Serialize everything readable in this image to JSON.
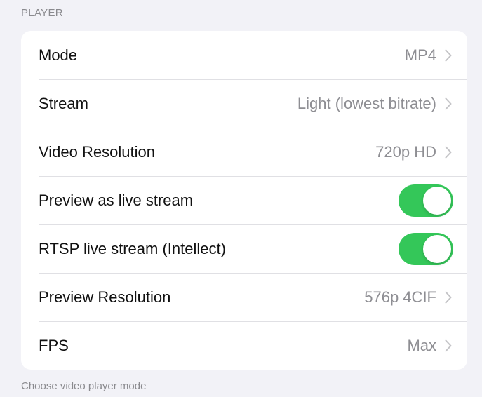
{
  "section": {
    "header": "PLAYER",
    "footer": "Choose video player mode"
  },
  "rows": [
    {
      "label": "Mode",
      "value": "MP4",
      "kind": "disclosure"
    },
    {
      "label": "Stream",
      "value": "Light (lowest bitrate)",
      "kind": "disclosure"
    },
    {
      "label": "Video Resolution",
      "value": "720p HD",
      "kind": "disclosure"
    },
    {
      "label": "Preview as live stream",
      "on": true,
      "kind": "toggle"
    },
    {
      "label": "RTSP live stream (Intellect)",
      "on": true,
      "kind": "toggle"
    },
    {
      "label": "Preview Resolution",
      "value": "576p 4CIF",
      "kind": "disclosure"
    },
    {
      "label": "FPS",
      "value": "Max",
      "kind": "disclosure"
    }
  ],
  "colors": {
    "background": "#f2f2f7",
    "card": "#ffffff",
    "toggle_on": "#34c759",
    "secondary_text": "#8e8e93"
  },
  "icons": {
    "disclosure": "chevron-right-icon"
  }
}
